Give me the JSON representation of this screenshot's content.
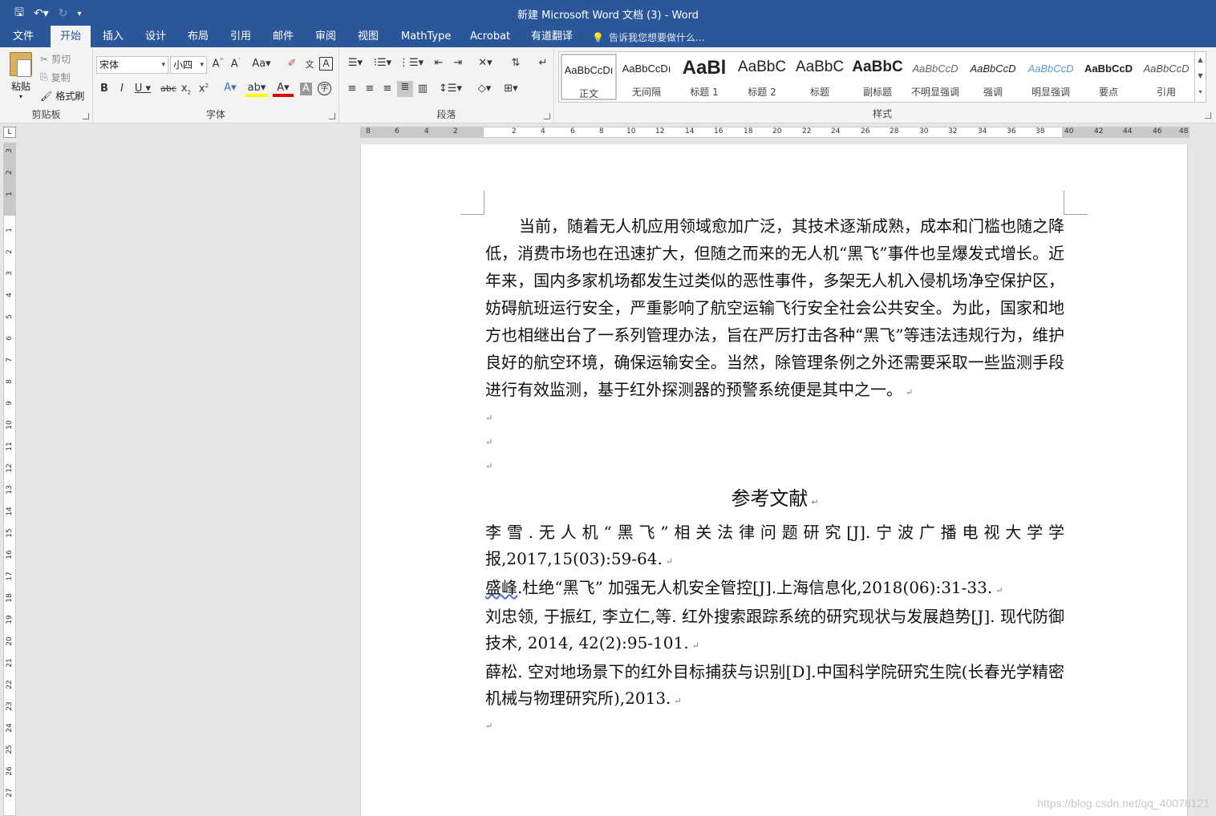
{
  "window": {
    "title": "新建 Microsoft Word 文档 (3) - Word"
  },
  "qat": {
    "save_icon": "save-icon",
    "undo_icon": "undo-icon",
    "redo_icon": "redo-icon",
    "customize_icon": "customize-icon"
  },
  "tabs": [
    "文件",
    "开始",
    "插入",
    "设计",
    "布局",
    "引用",
    "邮件",
    "审阅",
    "视图",
    "MathType",
    "Acrobat",
    "有道翻译"
  ],
  "active_tab": "开始",
  "tell_me": "告诉我您想要做什么...",
  "clipboard": {
    "paste": "粘贴",
    "cut": "剪切",
    "copy": "复制",
    "format_painter": "格式刷",
    "label": "剪贴板"
  },
  "font": {
    "name": "宋体",
    "size": "小四",
    "label": "字体"
  },
  "paragraph": {
    "label": "段落"
  },
  "styles": {
    "label": "样式",
    "items": [
      {
        "preview": "AaBbCcDı",
        "name": "正文"
      },
      {
        "preview": "AaBbCcDı",
        "name": "无间隔"
      },
      {
        "preview": "AaBl",
        "name": "标题 1"
      },
      {
        "preview": "AaBbC",
        "name": "标题 2"
      },
      {
        "preview": "AaBbC",
        "name": "标题"
      },
      {
        "preview": "AaBbC",
        "name": "副标题"
      },
      {
        "preview": "AaBbCcD",
        "name": "不明显强调"
      },
      {
        "preview": "AaBbCcD",
        "name": "强调"
      },
      {
        "preview": "AaBbCcD",
        "name": "明显强调"
      },
      {
        "preview": "AaBbCcD",
        "name": "要点"
      },
      {
        "preview": "AaBbCcD",
        "name": "引用"
      }
    ]
  },
  "document": {
    "paragraph": "当前，随着无人机应用领域愈加广泛，其技术逐渐成熟，成本和门槛也随之降低，消费市场也在迅速扩大，但随之而来的无人机“黑飞”事件也呈爆发式增长。近年来，国内多家机场都发生过类似的恶性事件，多架无人机入侵机场净空保护区，妨碍航班运行安全，严重影响了航空运输飞行安全社会公共安全。为此，国家和地方也相继出台了一系列管理办法，旨在严厉打击各种“黑飞”等违法违规行为，维护良好的航空环境，确保运输安全。当然，除管理条例之外还需要采取一些监测手段进行有效监测，基于红外探测器的预警系统便是其中之一。",
    "references_title": "参考文献",
    "references": [
      "李雪.无人机“黑飞”相关法律问题研究[J].宁波广播电视大学学报,2017,15(03):59-64.",
      "盛峰.杜绝“黑飞”  加强无人机安全管控[J].上海信息化,2018(06):31-33.",
      "刘忠领, 于振红, 李立仁,等. 红外搜索跟踪系统的研究现状与发展趋势[J]. 现代防御技术, 2014, 42(2):95-101.",
      "薛松. 空对地场景下的红外目标捕获与识别[D].中国科学院研究生院(长春光学精密机械与物理研究所),2013."
    ],
    "ref2_underlined": "盛峰",
    "ref2_rest": ".杜绝“黑飞”  加强无人机安全管控[J].上海信息化,2018(06):31-33."
  },
  "ruler": {
    "h_left_labels": [
      "8",
      "6",
      "4",
      "2"
    ],
    "h_right_labels": [
      "2",
      "4",
      "6",
      "8",
      "10",
      "12",
      "14",
      "16",
      "18",
      "20",
      "22",
      "24",
      "26",
      "28",
      "30",
      "32",
      "34",
      "36",
      "38",
      "40",
      "42",
      "44",
      "46",
      "48"
    ],
    "v_top_labels": [
      "3",
      "2",
      "1"
    ],
    "v_labels": [
      "1",
      "2",
      "3",
      "4",
      "5",
      "6",
      "7",
      "8",
      "9",
      "10",
      "11",
      "12",
      "13",
      "14",
      "15",
      "16",
      "17",
      "18",
      "19",
      "20",
      "21",
      "22",
      "23",
      "24",
      "25",
      "26",
      "27"
    ]
  },
  "watermark": "https://blog.csdn.net/qq_40078121",
  "colors": {
    "titlebar": "#2b579a",
    "ribbon": "#f3f3f3",
    "workspace": "#e6e6e6"
  }
}
